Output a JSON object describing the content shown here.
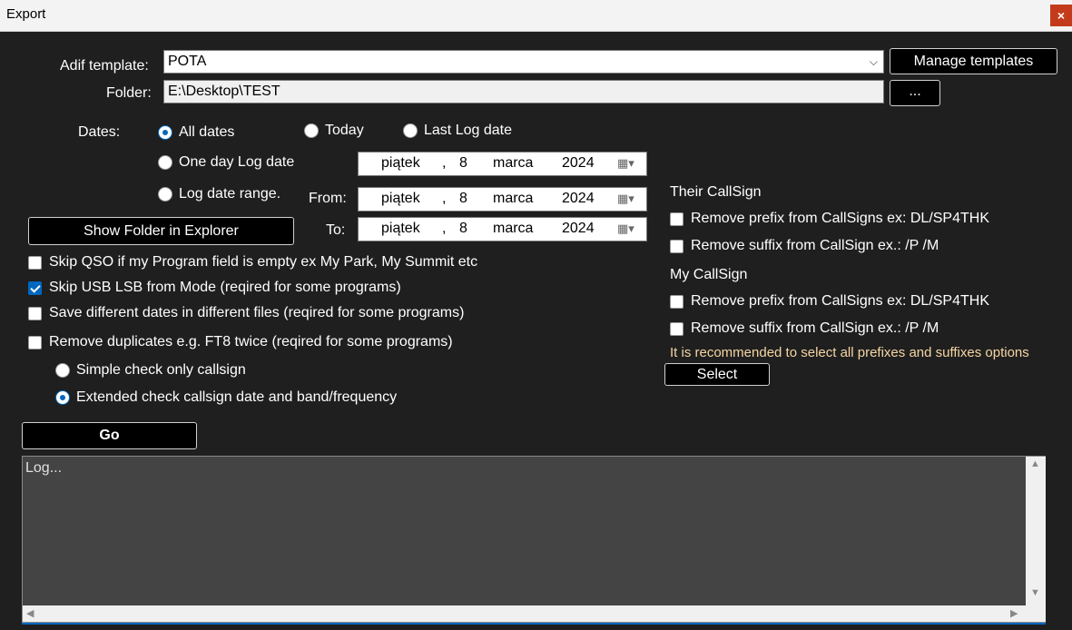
{
  "window": {
    "title": "Export",
    "close_glyph": "×"
  },
  "adif": {
    "label": "Adif template:",
    "value": "POTA",
    "manage_label": "Manage templates"
  },
  "folder": {
    "label": "Folder:",
    "value": "E:\\Desktop\\TEST",
    "browse_label": "..."
  },
  "dates": {
    "label": "Dates:",
    "all_dates": "All dates",
    "today": "Today",
    "last_log_date": "Last Log date",
    "one_day": "One day Log date",
    "range": "Log date range.",
    "from_label": "From:",
    "to_label": "To:",
    "one_day_value": {
      "weekday": "piątek",
      "sep": ",",
      "day": "8",
      "month": "marca",
      "year": "2024"
    },
    "from_value": {
      "weekday": "piątek",
      "sep": ",",
      "day": "8",
      "month": "marca",
      "year": "2024"
    },
    "to_value": {
      "weekday": "piątek",
      "sep": ",",
      "day": "8",
      "month": "marca",
      "year": "2024"
    }
  },
  "show_folder_label": "Show Folder in Explorer",
  "options": {
    "skip_qso": "Skip QSO if my Program field is empty ex My Park, My Summit etc",
    "skip_usb": "Skip USB LSB from Mode (reqired for some programs)",
    "save_dates": "Save different dates in different files  (reqired for some programs)",
    "remove_dup": "Remove duplicates e.g. FT8 twice (reqired for some programs)",
    "simple_check": "Simple check only callsign",
    "extended_check": "Extended check  callsign date and band/frequency"
  },
  "their_callsign": {
    "heading": "Their CallSign",
    "remove_prefix": "Remove prefix from CallSigns ex: DL/SP4THK",
    "remove_suffix": "Remove suffix from CallSign ex.: /P /M"
  },
  "my_callsign": {
    "heading": "My CallSign",
    "remove_prefix": "Remove prefix from CallSigns ex: DL/SP4THK",
    "remove_suffix": "Remove suffix from CallSign ex.: /P /M"
  },
  "recommend_note": "It is recommended to select all prefixes and suffixes options",
  "select_label": "Select",
  "go_label": "Go",
  "log": {
    "placeholder": "Log..."
  },
  "colors": {
    "accent": "#0067c0",
    "background": "#1f1f1f",
    "note": "#f6d6a3"
  }
}
